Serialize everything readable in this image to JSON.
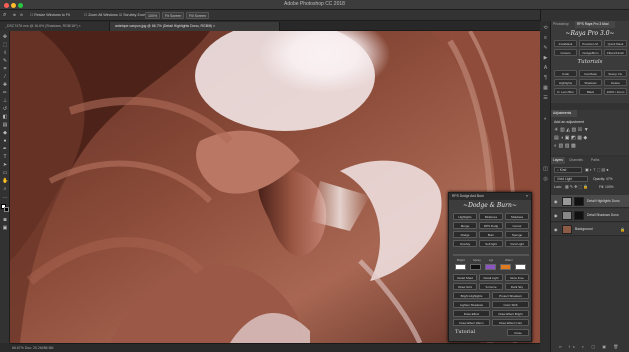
{
  "app": {
    "title": "Adobe Photoshop CC 2018"
  },
  "optionsbar": {
    "resize_windows": "Resize Windows to Fit",
    "zoom_all": "Zoom All Windows",
    "scrubby_zoom": "Scrubby Zoom",
    "zoom_pct": "100%",
    "fit_screen": "Fit Screen",
    "fill_screen": "Fill Screen"
  },
  "tabs": [
    {
      "label": "_DSC7476.nrw @ 16.6% (Shadows, RGB/16*) ×"
    },
    {
      "label": "antelope canyon.jpg @ 66.7% (Detail Highlights Dono, RGB/8) ×"
    }
  ],
  "status": {
    "text": "66.67%    Doc: 20.2M/86.5M"
  },
  "rightdock": {
    "tabs": [
      "Photoshop",
      "RPS Raya Pro 3 Mod"
    ],
    "raya": {
      "title": "~Raya Pro 3.0~",
      "buttons": [
        "InstaMask",
        "Precision M.",
        "Quick Mask",
        "Colours",
        "Dodge/Burn",
        "Filters/Finish"
      ],
      "tutorials": "Tutorials",
      "buttons2": [
        "Undo",
        "Cat.Mode",
        "Stamp Vis.",
        "Highlights",
        "Shadows",
        "Delete",
        "D. Lens Blur",
        "Black",
        "100% / Zoom"
      ]
    },
    "adjustments": {
      "tab": "Adjustments",
      "add": "Add an adjustment"
    },
    "layers": {
      "tabs": [
        "Layers",
        "Channels",
        "Paths"
      ],
      "kind": "Kind",
      "blend": "Vivid Light",
      "opacity": "Opacity: 47%",
      "lock": "Lock:",
      "fill": "Fill: 100%",
      "items": [
        {
          "name": "Detail Highlights Dono"
        },
        {
          "name": "Detail Shadows Dono"
        },
        {
          "name": "Background"
        }
      ]
    }
  },
  "dodgeburn": {
    "header": "RPS Dodge And Burn",
    "title": "~Dodge & Burn~",
    "grid1": [
      "Highlights",
      "Midtones",
      "Shadows",
      "Merge",
      "RPS Dodg",
      "Cursor",
      "Dodge",
      "Burn",
      "Sponge",
      "Overlay",
      "Soft light",
      "Vivid Light"
    ],
    "swatch_labels": [
      "Bright",
      "Spray",
      "Lgt",
      "Warm"
    ],
    "swatch_colors": [
      "#ffffff",
      "#111111",
      "#8c54c0",
      "#e07a20",
      "#ffffff"
    ],
    "grid2": [
      "Detail Shad",
      "Detail Light",
      "Glow Free",
      "Draw Grid",
      "S-Curve",
      "Dark Sky",
      "Bright Highlights",
      "Protect Shadows",
      "Lighten Shadows",
      "Color Shift",
      "Draw Effect",
      "Draw Effect Bright",
      "Draw Effect Warm",
      "Draw Effect Cold"
    ],
    "tutorial": "Tutorial",
    "close": "Close"
  }
}
